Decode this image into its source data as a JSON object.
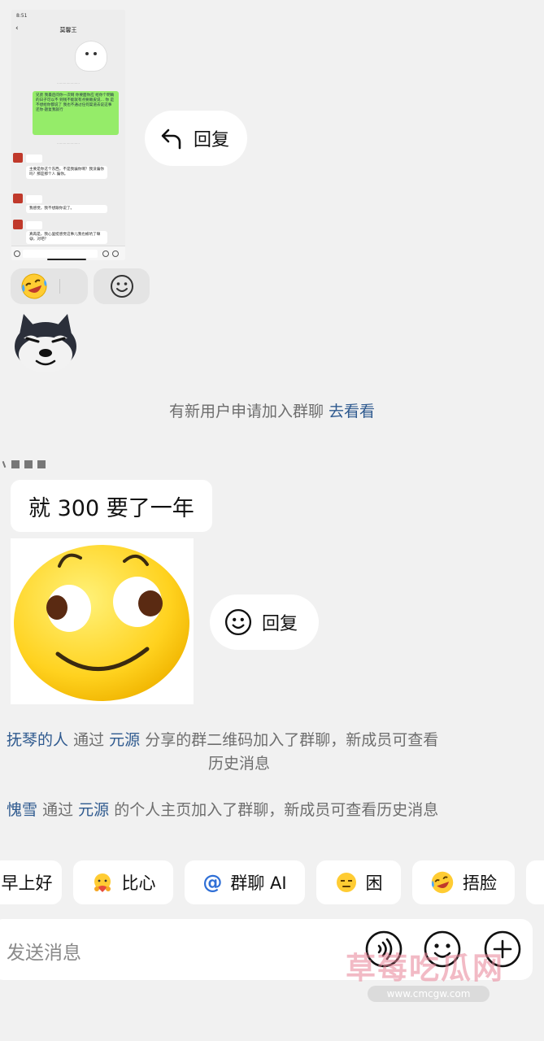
{
  "thumbnail": {
    "status_time": "8:51",
    "title": "莫馨王",
    "green_message": "兄弟 我最后问你一次啊 你要面你应 给你个明确的日子可以不 到钱不能就有点要赖皮说... 你 是不想给你都说了 我也不通过任何渠道去说这事 还你·题复我就行",
    "messages": [
      "主要是你这个东西，不是我骗你啊？我没骗你吗？那是那个人 骗你。",
      "我感觉，我不想跟你说了。",
      "真再是，我心里挺感觉这事儿我也被坑了嘛😅，对吧？"
    ]
  },
  "reply_label": "回复",
  "system_notices": {
    "join_request_text": "有新用户申请加入群聊",
    "join_request_link": "去看看",
    "qr_join_user": "抚琴的人",
    "qr_join_via": "通过",
    "qr_join_sharer": "元源",
    "qr_join_rest": "分享的群二维码加入了群聊，新成员可查看",
    "qr_join_rest_line2": "历史消息",
    "profile_join_user": "愧雪",
    "profile_join_via": "通过",
    "profile_join_sharer": "元源",
    "profile_join_rest": "的个人主页加入了群聊，新成员可查看历史消息"
  },
  "chat_message": "就 300 要了一年",
  "quick_chips": [
    {
      "label": "早上好"
    },
    {
      "label": "比心"
    },
    {
      "label": "群聊 AI"
    },
    {
      "label": "困"
    },
    {
      "label": "捂脸"
    }
  ],
  "input": {
    "placeholder": "发送消息"
  },
  "watermark": {
    "text": "草莓吃瓜网",
    "url": "www.cmcgw.com"
  }
}
